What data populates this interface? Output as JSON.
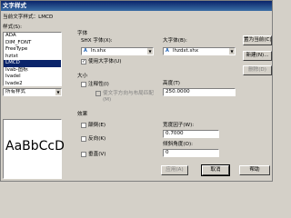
{
  "window": {
    "title": "文字样式"
  },
  "current_style": {
    "label": "当前文字样式：",
    "value": "LMCD"
  },
  "styles": {
    "label": "样式(S):",
    "items": [
      "ADA",
      "DIM_FONT",
      "FreeType",
      "hztxt",
      "LMCD",
      "Ivab-图标",
      "Ivadel",
      "Ivade2"
    ],
    "selected_index": 4
  },
  "filter": {
    "value": "所有样式"
  },
  "preview": {
    "text": "AaBbCcD"
  },
  "font": {
    "section": "字体",
    "shx_label": "SHX 字体(X):",
    "shx_value": "ln.shx",
    "big_label": "大字体(B):",
    "big_value": "lhzdxt.shx",
    "use_big_font": "使用大字体(U)"
  },
  "size": {
    "section": "大小",
    "annotative": "注释性(I)",
    "match_orientation": "使文字方向与布局匹配(M)",
    "height_label": "高度(T)",
    "height_value": "250.0000"
  },
  "effects": {
    "section": "效果",
    "upside_down": "颠倒(E)",
    "backwards": "反向(K)",
    "vertical": "垂直(V)",
    "width_label": "宽度因子(W):",
    "width_value": "0.7000",
    "oblique_label": "倾斜角度(O):",
    "oblique_value": "0"
  },
  "buttons": {
    "set_current": "置为当前(C)",
    "new": "新建(N)...",
    "delete": "删除(D)",
    "apply": "应用(A)",
    "cancel": "取消",
    "help": "帮助"
  }
}
